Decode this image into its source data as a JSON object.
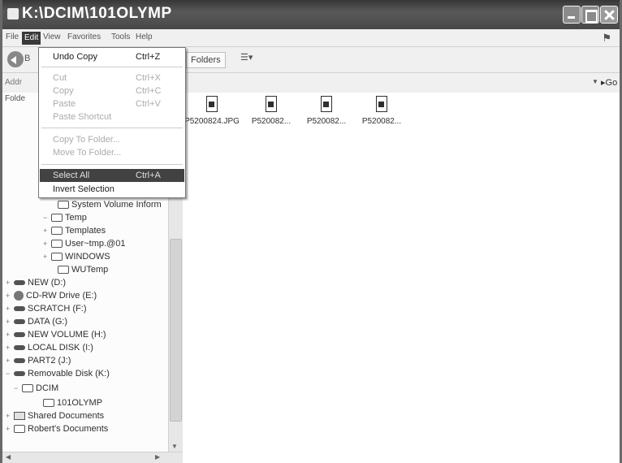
{
  "window": {
    "title": "K:\\DCIM\\101OLYMP"
  },
  "menubar": {
    "items": [
      "File",
      "Edit",
      "View",
      "Favorites",
      "Tools",
      "Help"
    ]
  },
  "toolbar": {
    "back_label": "B",
    "folders_label": "Folders",
    "views_label": "☰▾"
  },
  "address": {
    "label": "Addr",
    "go_label": "Go"
  },
  "folderpane": {
    "label": "Folde",
    "tree": [
      {
        "label": "System Volume Inform",
        "icon": "folder-icon",
        "expander": ""
      },
      {
        "label": "Temp",
        "icon": "folder-icon",
        "expander": "−"
      },
      {
        "label": "Templates",
        "icon": "folder-icon",
        "expander": "+"
      },
      {
        "label": "User~tmp.@01",
        "icon": "folder-icon",
        "expander": "+"
      },
      {
        "label": "WINDOWS",
        "icon": "folder-icon",
        "expander": "+"
      },
      {
        "label": "WUTemp",
        "icon": "folder-icon",
        "expander": ""
      },
      {
        "label": "NEW (D:)",
        "icon": "drive-icon",
        "expander": "+"
      },
      {
        "label": "CD-RW Drive (E:)",
        "icon": "cd-drive-icon",
        "expander": "+"
      },
      {
        "label": "SCRATCH (F:)",
        "icon": "drive-icon",
        "expander": "+"
      },
      {
        "label": "DATA (G:)",
        "icon": "drive-icon",
        "expander": "+"
      },
      {
        "label": "NEW VOLUME (H:)",
        "icon": "drive-icon",
        "expander": "+"
      },
      {
        "label": "LOCAL DISK (I:)",
        "icon": "drive-icon",
        "expander": "+"
      },
      {
        "label": "PART2 (J:)",
        "icon": "drive-icon",
        "expander": "+"
      },
      {
        "label": "Removable Disk (K:)",
        "icon": "drive-icon",
        "expander": "−"
      },
      {
        "label": "DCIM",
        "icon": "folder-icon",
        "expander": "−"
      },
      {
        "label": "101OLYMP",
        "icon": "folder-icon",
        "expander": ""
      },
      {
        "label": "Shared Documents",
        "icon": "shared-folder-icon",
        "expander": "+"
      },
      {
        "label": "Robert's Documents",
        "icon": "folder-icon",
        "expander": "+"
      }
    ]
  },
  "files": [
    {
      "name": "P5200824.JPG"
    },
    {
      "name": "P520082..."
    },
    {
      "name": "P520082..."
    },
    {
      "name": "P520082..."
    }
  ],
  "edit_menu": {
    "items": [
      {
        "label": "Undo Copy",
        "shortcut": "Ctrl+Z",
        "state": "enabled"
      },
      {
        "label": "Cut",
        "shortcut": "Ctrl+X",
        "state": "disabled"
      },
      {
        "label": "Copy",
        "shortcut": "Ctrl+C",
        "state": "disabled"
      },
      {
        "label": "Paste",
        "shortcut": "Ctrl+V",
        "state": "disabled"
      },
      {
        "label": "Paste Shortcut",
        "shortcut": "",
        "state": "disabled"
      },
      {
        "label": "Copy To Folder...",
        "shortcut": "",
        "state": "disabled"
      },
      {
        "label": "Move To Folder...",
        "shortcut": "",
        "state": "disabled"
      },
      {
        "label": "Select All",
        "shortcut": "Ctrl+A",
        "state": "selected"
      },
      {
        "label": "Invert Selection",
        "shortcut": "",
        "state": "enabled"
      }
    ]
  }
}
